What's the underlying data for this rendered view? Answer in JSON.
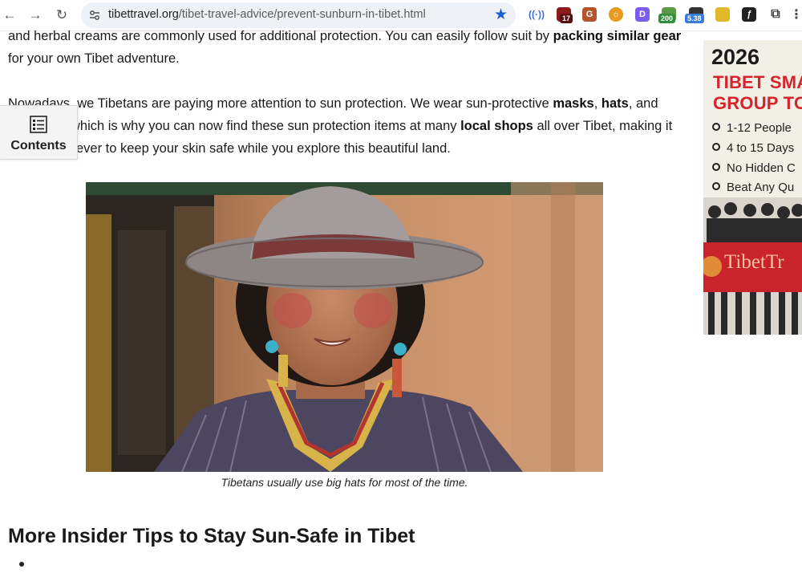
{
  "browser": {
    "url_domain": "tibettravel.org",
    "url_path": "/tibet-travel-advice/prevent-sunburn-in-tibet.html",
    "extension_badges": [
      "17",
      "200",
      "5.38"
    ]
  },
  "toc": {
    "label": "Contents"
  },
  "article": {
    "para1_line1_text": "and herbal creams are commonly used for additional protection. You can easily follow suit by ",
    "para1_line1_bold": "packing similar gear",
    "para1_line2": "for your own Tibet adventure.",
    "para2_line1_text": "Nowadays, we Tibetans are paying more attention to sun protection. We wear sun-protective ",
    "para2_bold_masks": "masks",
    "para2_bold_hats": "hats",
    "para2_line1_end": ", and",
    "para2_line2_text": "which is why you can now find these sun protection items at many ",
    "para2_bold_shops": "local shops",
    "para2_line2_end": " all over Tibet, making it",
    "para2_line3": "ever to keep your skin safe while you explore this beautiful land.",
    "caption": "Tibetans usually use big hats for most of the time.",
    "heading": "More Insider Tips to Stay Sun-Safe in Tibet"
  },
  "ad": {
    "year": "2026",
    "title_line1": "TIBET SMA",
    "title_line2": "GROUP TO",
    "bullets": [
      "1-12 People",
      "4 to 15 Days",
      "No Hidden C",
      "Beat Any Qu"
    ],
    "brand": "TibetTr"
  },
  "colors": {
    "accent_blue": "#1a5fd6",
    "ad_red": "#d6242a"
  }
}
